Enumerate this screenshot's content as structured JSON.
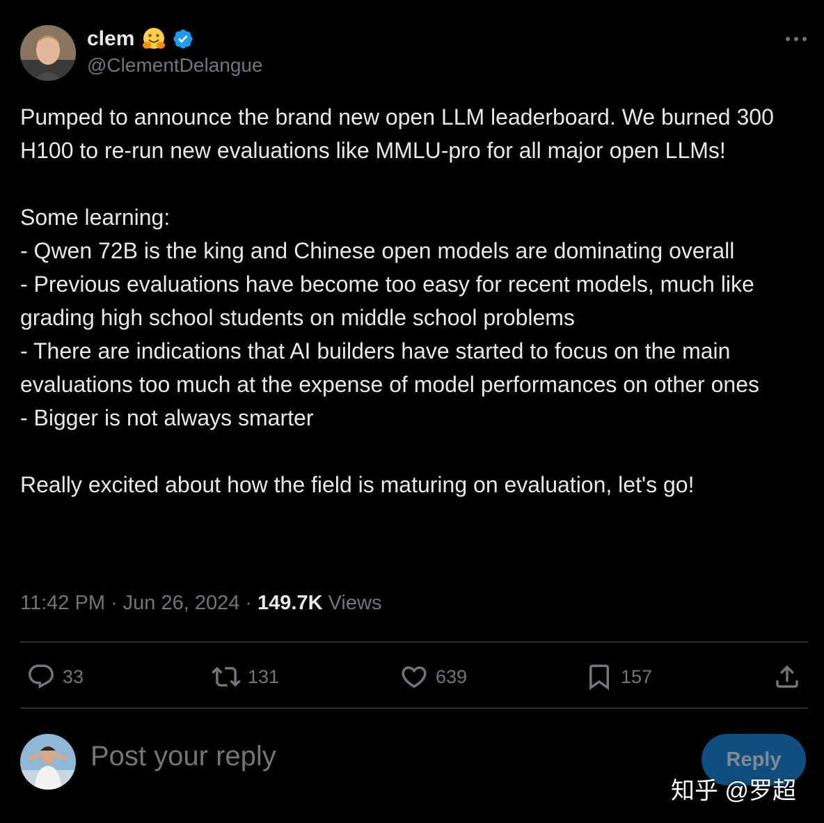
{
  "author": {
    "name": "clem",
    "handle": "@ClementDelangue",
    "emoji_icon": "hugging-face-emoji",
    "verified_icon": "verified-badge-icon"
  },
  "tweet": {
    "text": "Pumped to announce the brand new open LLM leaderboard. We burned 300 H100 to re-run new evaluations like MMLU-pro for all major open LLMs!\n\nSome learning:\n- Qwen 72B is the king and Chinese open models are dominating overall\n- Previous evaluations have become too easy for recent models, much like grading high school students on middle school problems\n- There are indications that AI builders have started to focus on the main evaluations too much at the expense of model performances on other ones\n- Bigger is not always smarter\n\nReally excited about how the field is maturing on evaluation, let's go!",
    "time": "11:42 PM",
    "date": "Jun 26, 2024",
    "views_count": "149.7K",
    "views_label": "Views"
  },
  "actions": {
    "replies": "33",
    "reposts": "131",
    "likes": "639",
    "bookmarks": "157"
  },
  "reply_box": {
    "placeholder": "Post your reply",
    "button_label": "Reply"
  },
  "watermark": "知乎 @罗超",
  "colors": {
    "background": "#000000",
    "text": "#e7e9ea",
    "muted": "#71767b",
    "divider": "#2f3336",
    "accent": "#1d9bf0",
    "reply_button_disabled": "#0f4e7e"
  }
}
